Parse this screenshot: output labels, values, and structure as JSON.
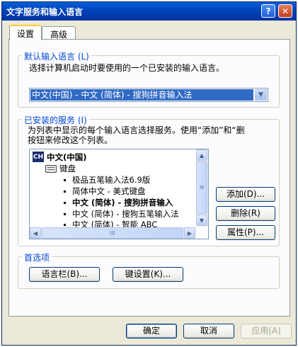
{
  "window": {
    "title": "文字服务和输入语言",
    "help_glyph": "?",
    "close_glyph": "✕"
  },
  "tabs": [
    {
      "label": "设置",
      "active": true
    },
    {
      "label": "高级",
      "active": false
    }
  ],
  "default_lang": {
    "legend": "默认输入语言 (L)",
    "description": "选择计算机启动时要使用的一个已安装的输入语言。",
    "selected": "中文(中国) - 中文 (简体) - 搜狗拼音输入法"
  },
  "services": {
    "legend": "已安装的服务 (I)",
    "description_line1": "为列表中显示的每个输入语言选择服务。使用“添加”和“删",
    "description_line2": "按钮来修改这个列表。",
    "root": {
      "badge": "CH",
      "label": "中文(中国)"
    },
    "category": "键盘",
    "items": [
      {
        "label": "极品五笔输入法6.9版",
        "bold": false
      },
      {
        "label": "简体中文 - 美式键盘",
        "bold": false
      },
      {
        "label": "中文 (简体) - 搜狗拼音输入",
        "bold": true
      },
      {
        "label": "中文 (简体) - 搜狗五笔输入法",
        "bold": false
      },
      {
        "label": "中文 (简体) - 智能 ABC",
        "bold": false
      }
    ],
    "add_button": "添加(D)...",
    "remove_button": "删除(R)",
    "props_button": "属性(P)..."
  },
  "prefs": {
    "legend": "首选项",
    "langbar_button": "语言栏(B)...",
    "keysettings_button": "键设置(K)..."
  },
  "footer": {
    "ok": "确定",
    "cancel": "取消",
    "apply": "应用(A)"
  },
  "icons": {
    "dropdown": "▼",
    "scroll_up": "▲",
    "scroll_down": "▼",
    "scroll_left": "◀",
    "scroll_right": "▶",
    "thumb_grip": "≡",
    "thumb_grip_h": "III"
  }
}
